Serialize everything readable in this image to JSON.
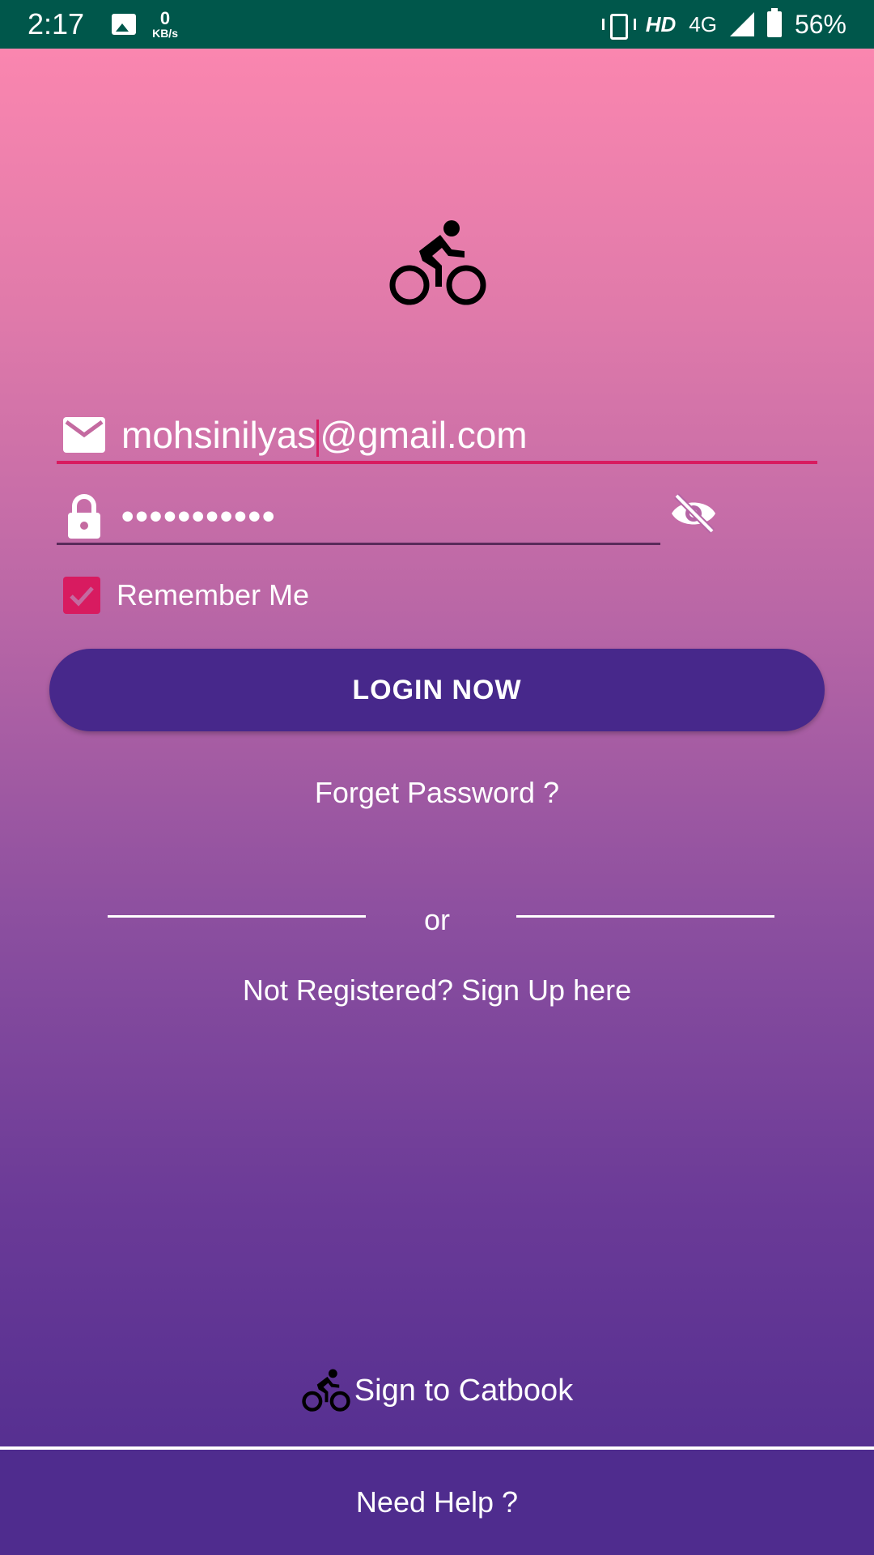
{
  "status_bar": {
    "time": "2:17",
    "kbs_value": "0",
    "kbs_unit": "KB/s",
    "hd": "HD",
    "network": "4G",
    "battery": "56%"
  },
  "login": {
    "email_value_before_caret": "mohsinilyas",
    "email_value_after_caret": "@gmail.com",
    "password_masked": "•••••••••••",
    "remember_label": "Remember Me",
    "remember_checked": true,
    "login_button": "LOGIN NOW",
    "forgot_link": "Forget Password ?",
    "or_text": "or",
    "signup_link": "Not Registered? Sign Up here"
  },
  "brand": {
    "label": "Sign to Catbook",
    "icon": "bike-icon"
  },
  "footer": {
    "help_label": "Need Help ?"
  },
  "colors": {
    "accent": "#d81b60",
    "button": "#47288b",
    "status_bar": "#00574b",
    "footer": "#4f2c8e"
  }
}
